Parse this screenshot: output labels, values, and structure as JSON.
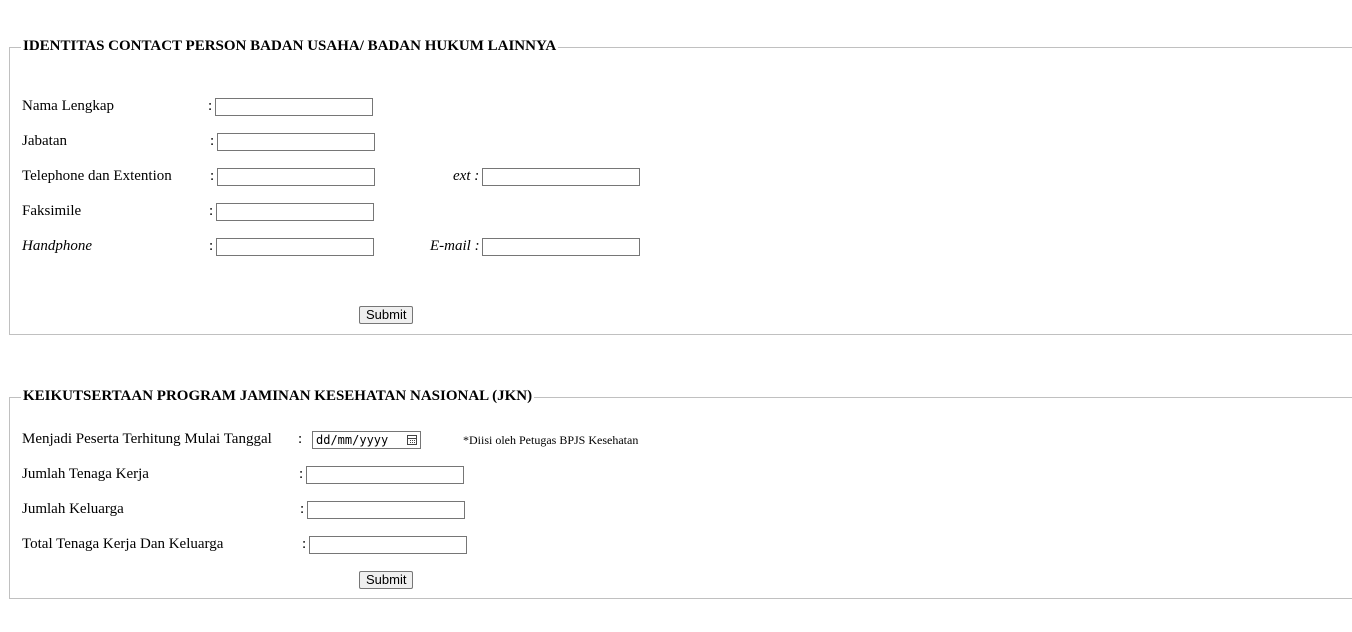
{
  "section1": {
    "legend": "IDENTITAS CONTACT PERSON BADAN USAHA/ BADAN HUKUM LAINNYA",
    "colon": ":",
    "fields": {
      "nama_lengkap": {
        "label": "Nama Lengkap",
        "value": ""
      },
      "jabatan": {
        "label": "Jabatan",
        "value": ""
      },
      "telephone": {
        "label": "Telephone dan Extention",
        "value": ""
      },
      "ext": {
        "label": "ext :",
        "value": ""
      },
      "faksimile": {
        "label": "Faksimile",
        "value": ""
      },
      "handphone": {
        "label": "Handphone",
        "value": ""
      },
      "email": {
        "label": "E-mail :",
        "value": ""
      }
    },
    "submit_label": "Submit"
  },
  "section2": {
    "legend": "KEIKUTSERTAAN PROGRAM JAMINAN KESEHATAN NASIONAL (JKN)",
    "colon": ":",
    "fields": {
      "tanggal": {
        "label": "Menjadi Peserta Terhitung Mulai Tanggal",
        "placeholder": "dd/mm/yyyy"
      },
      "tenaga_kerja": {
        "label": "Jumlah Tenaga Kerja",
        "value": ""
      },
      "keluarga": {
        "label": "Jumlah Keluarga",
        "value": ""
      },
      "total": {
        "label": "Total Tenaga Kerja Dan Keluarga",
        "value": ""
      }
    },
    "note": "*Diisi oleh Petugas BPJS Kesehatan",
    "submit_label": "Submit"
  }
}
